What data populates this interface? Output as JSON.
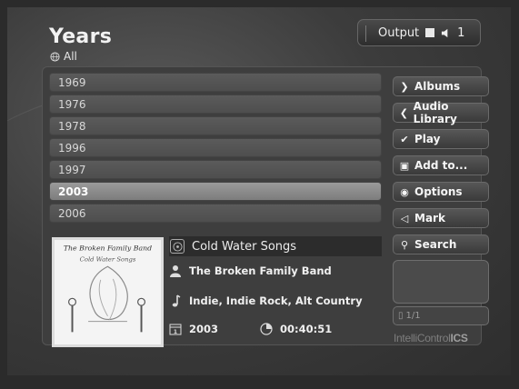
{
  "header": {
    "title": "Years",
    "filter_label": "All"
  },
  "output": {
    "label": "Output",
    "volume": "1"
  },
  "years": [
    "1969",
    "1976",
    "1978",
    "1996",
    "1997",
    "2003",
    "2006"
  ],
  "selected_year": "2003",
  "now_playing": {
    "album": "Cold Water Songs",
    "artist": "The Broken Family Band",
    "genres": "Indie, Indie Rock, Alt Country",
    "year": "2003",
    "duration": "00:40:51",
    "cover_text": "The Broken Family Band",
    "cover_subtext": "Cold Water Songs"
  },
  "buttons": {
    "albums": "Albums",
    "audio_library": "Audio Library",
    "play": "Play",
    "add_to": "Add to...",
    "options": "Options",
    "mark": "Mark",
    "search": "Search"
  },
  "pager": "1/1",
  "brand": {
    "light": "IntelliControl",
    "bold": "ICS"
  },
  "colors": {
    "background": "#2b2b2b",
    "selected_row": "#8a8a8a",
    "row": "#555555"
  }
}
